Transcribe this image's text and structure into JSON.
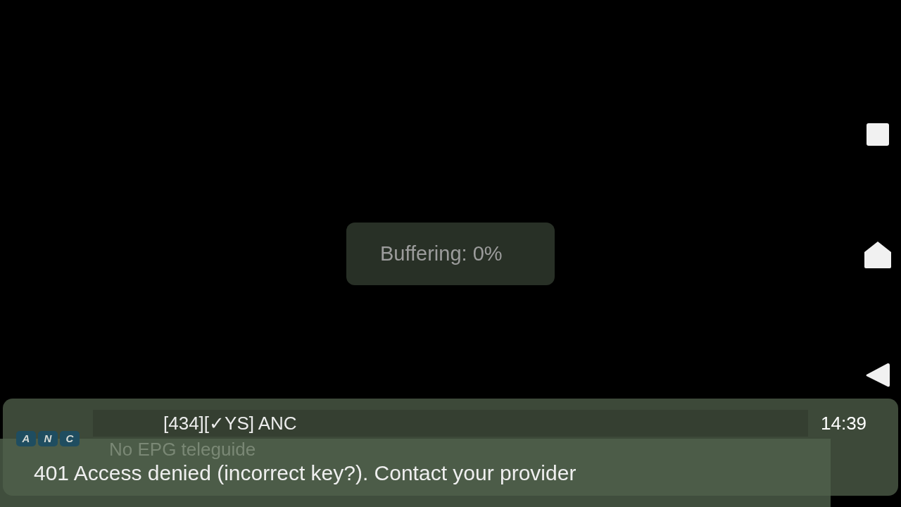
{
  "player": {
    "buffering": "Buffering: 0%"
  },
  "nav_bar": {
    "buttons": [
      {
        "kind": "recents"
      },
      {
        "kind": "home"
      },
      {
        "kind": "back"
      }
    ]
  },
  "channel_panel": {
    "logo": {
      "letters": [
        "A",
        "N",
        "C"
      ]
    },
    "title": "[434][✓YS] ANC",
    "epg": "No EPG teleguide",
    "time": "14:39"
  },
  "toast": {
    "message": "401 Access denied (incorrect key?). Contact your provider"
  }
}
